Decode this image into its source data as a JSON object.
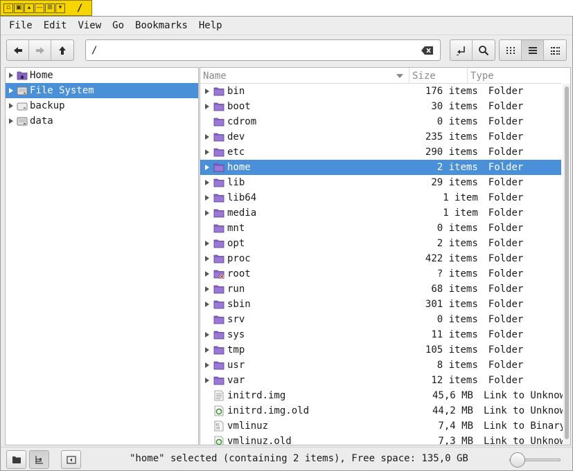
{
  "window": {
    "title": "/",
    "titlebar_buttons": [
      "minimize-icon",
      "restore-icon",
      "shade-icon",
      "stick-icon",
      "maximize-icon",
      "close-icon"
    ]
  },
  "menubar": {
    "items": [
      "File",
      "Edit",
      "View",
      "Go",
      "Bookmarks",
      "Help"
    ]
  },
  "toolbar": {
    "location_value": "/",
    "icons": {
      "back": "arrow-left-icon",
      "forward": "arrow-right-icon",
      "up": "arrow-up-icon",
      "clear": "backspace-icon",
      "open_location": "return-icon",
      "search": "search-icon",
      "view_icons": "icon-view-icon",
      "view_list": "list-view-icon",
      "view_compact": "compact-view-icon"
    }
  },
  "sidebar": {
    "items": [
      {
        "label": "Home",
        "icon": "home-folder-icon",
        "selected": false
      },
      {
        "label": "File System",
        "icon": "drive-icon",
        "selected": true
      },
      {
        "label": "backup",
        "icon": "drive-icon",
        "selected": false
      },
      {
        "label": "data",
        "icon": "drive-icon",
        "selected": false
      }
    ]
  },
  "filelist": {
    "columns": {
      "name": "Name",
      "size": "Size",
      "type": "Type"
    },
    "rows": [
      {
        "name": "bin",
        "size": "176 items",
        "type": "Folder",
        "icon": "folder",
        "expander": true
      },
      {
        "name": "boot",
        "size": "30 items",
        "type": "Folder",
        "icon": "folder",
        "expander": true
      },
      {
        "name": "cdrom",
        "size": "0 items",
        "type": "Folder",
        "icon": "folder",
        "expander": false
      },
      {
        "name": "dev",
        "size": "235 items",
        "type": "Folder",
        "icon": "folder",
        "expander": true
      },
      {
        "name": "etc",
        "size": "290 items",
        "type": "Folder",
        "icon": "folder",
        "expander": true
      },
      {
        "name": "home",
        "size": "2 items",
        "type": "Folder",
        "icon": "folder",
        "expander": true,
        "selected": true
      },
      {
        "name": "lib",
        "size": "29 items",
        "type": "Folder",
        "icon": "folder",
        "expander": true
      },
      {
        "name": "lib64",
        "size": "1 item",
        "type": "Folder",
        "icon": "folder",
        "expander": true
      },
      {
        "name": "media",
        "size": "1 item",
        "type": "Folder",
        "icon": "folder",
        "expander": true
      },
      {
        "name": "mnt",
        "size": "0 items",
        "type": "Folder",
        "icon": "folder",
        "expander": false
      },
      {
        "name": "opt",
        "size": "2 items",
        "type": "Folder",
        "icon": "folder",
        "expander": true
      },
      {
        "name": "proc",
        "size": "422 items",
        "type": "Folder",
        "icon": "folder",
        "expander": true
      },
      {
        "name": "root",
        "size": "? items",
        "type": "Folder",
        "icon": "folder-locked",
        "expander": true
      },
      {
        "name": "run",
        "size": "68 items",
        "type": "Folder",
        "icon": "folder",
        "expander": true
      },
      {
        "name": "sbin",
        "size": "301 items",
        "type": "Folder",
        "icon": "folder",
        "expander": true
      },
      {
        "name": "srv",
        "size": "0 items",
        "type": "Folder",
        "icon": "folder",
        "expander": false
      },
      {
        "name": "sys",
        "size": "11 items",
        "type": "Folder",
        "icon": "folder",
        "expander": true
      },
      {
        "name": "tmp",
        "size": "105 items",
        "type": "Folder",
        "icon": "folder",
        "expander": true
      },
      {
        "name": "usr",
        "size": "8 items",
        "type": "Folder",
        "icon": "folder",
        "expander": true
      },
      {
        "name": "var",
        "size": "12 items",
        "type": "Folder",
        "icon": "folder",
        "expander": true
      },
      {
        "name": "initrd.img",
        "size": "45,6 MB",
        "type": "Link to Unknown",
        "icon": "text-file",
        "expander": false
      },
      {
        "name": "initrd.img.old",
        "size": "44,2 MB",
        "type": "Link to Unknown",
        "icon": "recycle-file",
        "expander": false
      },
      {
        "name": "vmlinuz",
        "size": "7,4 MB",
        "type": "Link to Binary",
        "icon": "binary-file",
        "expander": false
      },
      {
        "name": "vmlinuz.old",
        "size": "7,3 MB",
        "type": "Link to Unknown",
        "icon": "recycle-file",
        "expander": false
      }
    ]
  },
  "statusbar": {
    "text": "\"home\" selected (containing 2 items), Free space: 135,0 GB",
    "zoom_level": 0.1
  },
  "colors": {
    "selection": "#4a90d9",
    "titlebar": "#f6d400",
    "folder": "#8a63c9"
  }
}
